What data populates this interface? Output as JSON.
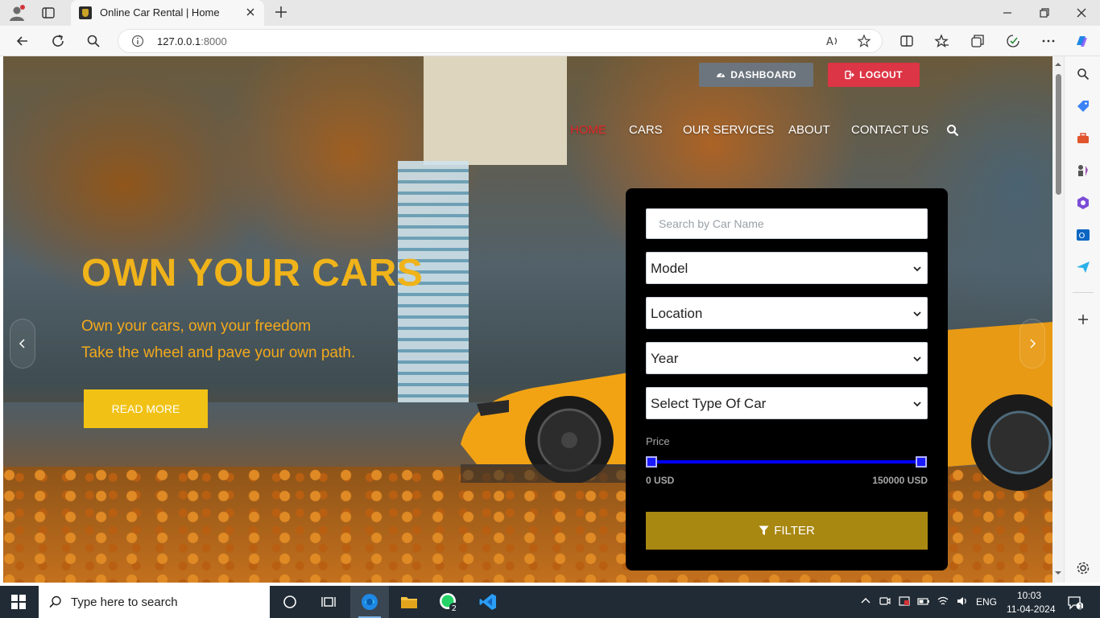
{
  "browser": {
    "tab_title": "Online Car Rental | Home",
    "url_host": "127.0.0.1",
    "url_port": ":8000"
  },
  "header": {
    "dashboard_label": "DASHBOARD",
    "logout_label": "LOGOUT",
    "nav": [
      {
        "label": "HOME",
        "active": true
      },
      {
        "label": "CARS"
      },
      {
        "label": "OUR SERVICES"
      },
      {
        "label": "ABOUT"
      },
      {
        "label": "CONTACT US"
      }
    ]
  },
  "hero": {
    "title": "OWN YOUR CARS",
    "line1": "Own your cars, own your freedom",
    "line2": "Take the wheel and pave your own path.",
    "cta_label": "READ MORE"
  },
  "filter": {
    "search_placeholder": "Search by Car Name",
    "model": "Model",
    "location": "Location",
    "year": "Year",
    "car_type": "Select Type Of Car",
    "price_label": "Price",
    "price_min": "0 USD",
    "price_max": "150000 USD",
    "price_range_fraction": [
      0,
      1
    ],
    "button_label": "FILTER"
  },
  "taskbar": {
    "search_placeholder": "Type here to search",
    "whatsapp_badge": "2",
    "language": "ENG",
    "time": "10:03",
    "date": "11-04-2024",
    "notification_count": "1"
  },
  "colors": {
    "accent_yellow": "#f1c215",
    "hero_text": "#f0b31a",
    "logout_red": "#dc3545",
    "dashboard_gray": "#6c757d",
    "filter_gold": "#a88811",
    "slider_blue": "#0000ff",
    "nav_active_red": "#e52a2a"
  }
}
